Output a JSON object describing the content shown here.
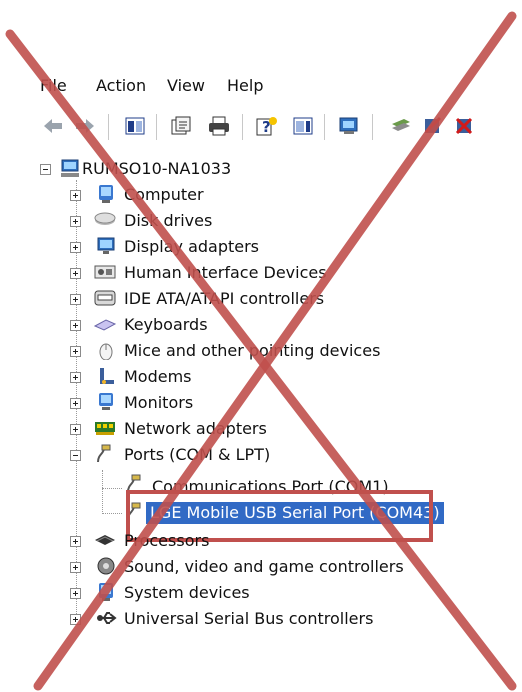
{
  "menu": {
    "file": "File",
    "action": "Action",
    "view": "View",
    "help": "Help"
  },
  "tree": {
    "root": "RUMSO10-NA1033",
    "items": [
      {
        "label": "Computer",
        "icon": "computer-icon"
      },
      {
        "label": "Disk drives",
        "icon": "disk-drive-icon"
      },
      {
        "label": "Display adapters",
        "icon": "display-adapter-icon"
      },
      {
        "label": "Human Interface Devices",
        "icon": "hid-icon"
      },
      {
        "label": "IDE ATA/ATAPI controllers",
        "icon": "ide-controller-icon"
      },
      {
        "label": "Keyboards",
        "icon": "keyboard-icon"
      },
      {
        "label": "Mice and other pointing devices",
        "icon": "mouse-icon"
      },
      {
        "label": "Modems",
        "icon": "modem-icon"
      },
      {
        "label": "Monitors",
        "icon": "monitor-icon"
      },
      {
        "label": "Network adapters",
        "icon": "network-adapter-icon"
      },
      {
        "label": "Ports (COM & LPT)",
        "icon": "port-icon"
      },
      {
        "label": "Processors",
        "icon": "processor-icon"
      },
      {
        "label": "Sound, video and game controllers",
        "icon": "sound-icon"
      },
      {
        "label": "System devices",
        "icon": "system-device-icon"
      },
      {
        "label": "Universal Serial Bus controllers",
        "icon": "usb-icon"
      }
    ],
    "ports_children": [
      "Communications Port (COM1)",
      "LGE Mobile USB Serial Port (COM43)"
    ]
  },
  "colors": {
    "cross": "#c0504d",
    "highlight_border": "#c0504d",
    "selection": "#316ac5"
  }
}
